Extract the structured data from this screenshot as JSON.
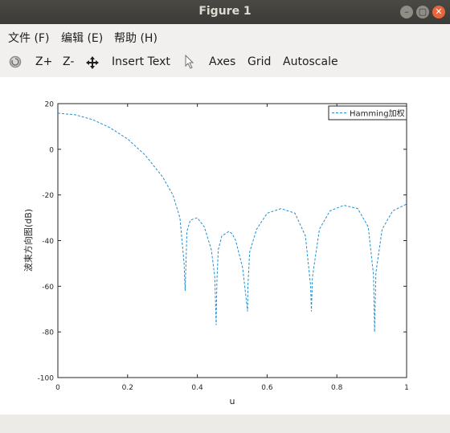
{
  "window": {
    "title": "Figure 1"
  },
  "menu": {
    "file": "文件 (F)",
    "edit": "编辑 (E)",
    "help": "帮助 (H)"
  },
  "toolbar": {
    "zoom_in": "Z+",
    "zoom_out": "Z-",
    "insert_text": "Insert Text",
    "axes": "Axes",
    "grid": "Grid",
    "autoscale": "Autoscale"
  },
  "chart_data": {
    "type": "line",
    "xlabel": "u",
    "ylabel": "波束方向图(dB)",
    "xlim": [
      0,
      1
    ],
    "ylim": [
      -100,
      20
    ],
    "xticks": [
      "0",
      "0.2",
      "0.4",
      "0.6",
      "0.8",
      "1"
    ],
    "yticks": [
      "20",
      "0",
      "-20",
      "-40",
      "-60",
      "-80",
      "-100"
    ],
    "grid": false,
    "legend_position": "top-right",
    "line_color": "#1f8fd1",
    "line_style": "dashed",
    "series": [
      {
        "name": "Hamming加权",
        "x": [
          0,
          0.05,
          0.1,
          0.15,
          0.2,
          0.25,
          0.3,
          0.33,
          0.35,
          0.362,
          0.365,
          0.37,
          0.38,
          0.4,
          0.42,
          0.44,
          0.45,
          0.454,
          0.456,
          0.46,
          0.47,
          0.49,
          0.5,
          0.51,
          0.53,
          0.544,
          0.545,
          0.55,
          0.57,
          0.6,
          0.64,
          0.68,
          0.71,
          0.725,
          0.727,
          0.73,
          0.75,
          0.78,
          0.82,
          0.86,
          0.89,
          0.905,
          0.908,
          0.912,
          0.93,
          0.96,
          1.0
        ],
        "y": [
          15.8,
          15.1,
          13.0,
          9.4,
          4.5,
          -2.5,
          -12,
          -20,
          -30,
          -50,
          -62,
          -36,
          -31,
          -30,
          -34,
          -44,
          -56,
          -77,
          -58,
          -44,
          -38,
          -36,
          -37,
          -40,
          -52,
          -71,
          -60,
          -45,
          -35,
          -28,
          -26,
          -28,
          -38,
          -60,
          -71,
          -56,
          -35,
          -27,
          -24.5,
          -26,
          -34,
          -55,
          -80,
          -54,
          -35,
          -27,
          -24
        ]
      }
    ]
  }
}
